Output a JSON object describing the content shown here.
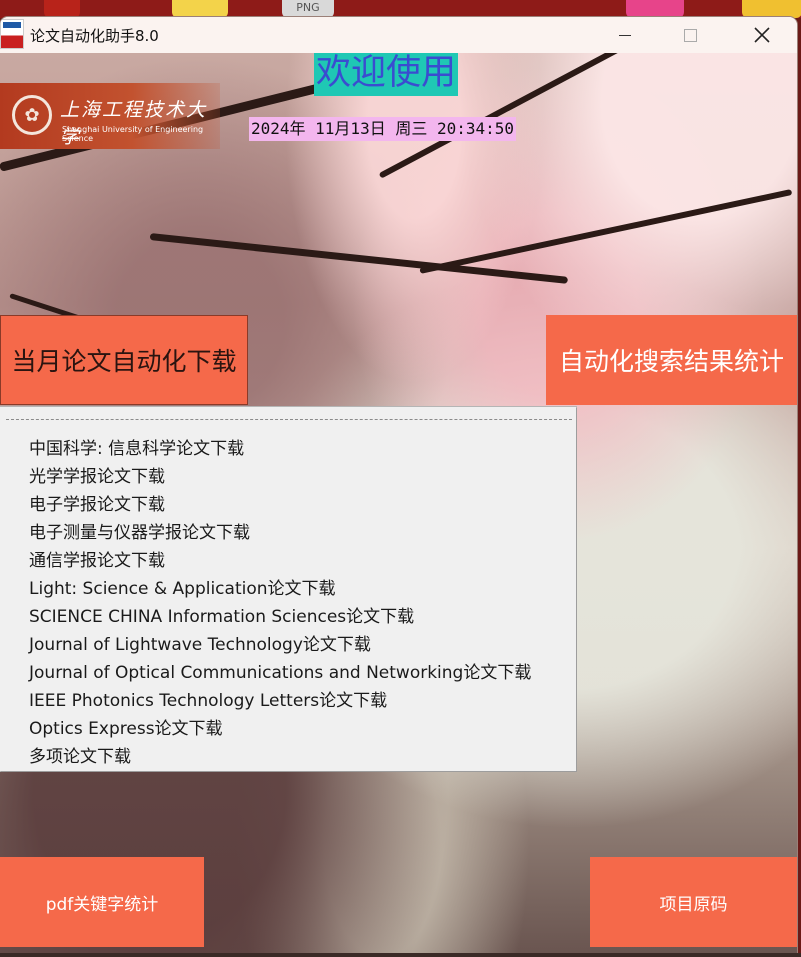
{
  "desktop": {
    "icon_label": "PNG"
  },
  "window": {
    "title": "论文自动化助手8.0",
    "minimize_label": "—",
    "maximize_label": "☐",
    "close_label": "✕"
  },
  "header": {
    "school_name_cn": "上海工程技术大学",
    "school_name_en": "Shanghai University of Engineering Science",
    "welcome": "欢迎使用",
    "datetime": "2024年 11月13日 周三 20:34:50"
  },
  "buttons": {
    "monthly_download": "当月论文自动化下载",
    "search_stats": "自动化搜索结果统计",
    "pdf_keyword_stats": "pdf关键字统计",
    "project_source": "项目原码"
  },
  "menu": {
    "items": [
      "中国科学: 信息科学论文下载",
      "光学学报论文下载",
      "电子学报论文下载",
      "电子测量与仪器学报论文下载",
      "通信学报论文下载",
      "Light: Science & Application论文下载",
      "SCIENCE CHINA Information Sciences论文下载",
      "Journal of Lightwave Technology论文下载",
      "Journal of Optical Communications and Networking论文下载",
      "IEEE Photonics Technology Letters论文下载",
      "Optics Express论文下载",
      "多项论文下载"
    ]
  },
  "colors": {
    "button_bg": "#f5694a",
    "welcome_bg": "#1fc8b4",
    "welcome_text": "#3a4cd0",
    "datetime_bg": "#f3b6ee",
    "menu_bg": "#f0f0f0"
  }
}
